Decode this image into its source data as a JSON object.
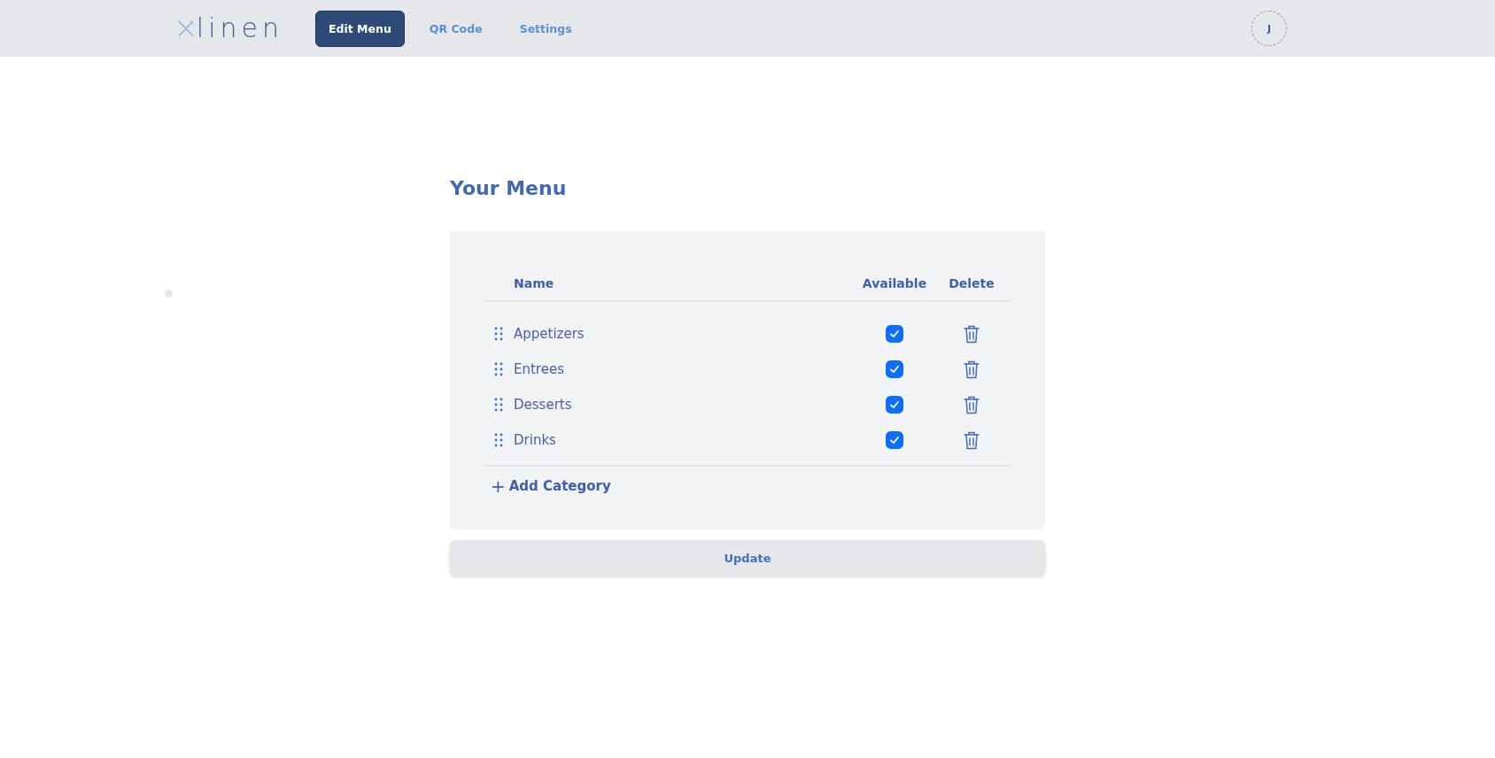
{
  "header": {
    "logo_text": "linen",
    "tabs": [
      {
        "label": "Edit Menu",
        "selected": true
      },
      {
        "label": "QR Code",
        "selected": false
      },
      {
        "label": "Settings",
        "selected": false
      }
    ],
    "avatar_initial": "J"
  },
  "title": "Your Menu",
  "table": {
    "columns": [
      "Name",
      "Available",
      "Delete"
    ],
    "rows": [
      {
        "name": "Appetizers",
        "available": true
      },
      {
        "name": "Entrees",
        "available": true
      },
      {
        "name": "Desserts",
        "available": true
      },
      {
        "name": "Drinks",
        "available": true
      }
    ]
  },
  "add_button": {
    "icon": "+",
    "label": "Add Category"
  },
  "update_button": "Update"
}
